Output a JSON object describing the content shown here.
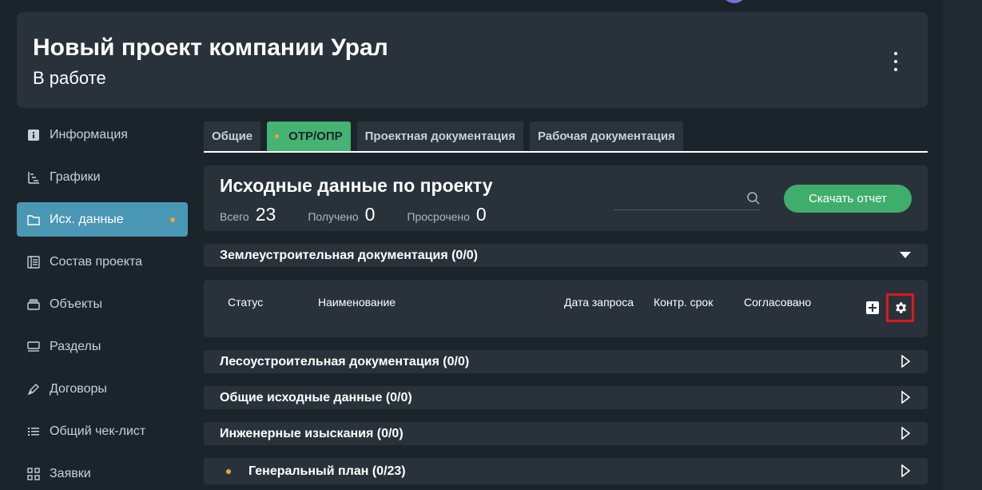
{
  "header": {
    "title": "Новый проект компании Урал",
    "status": "В работе",
    "menu_icon": "kebab-menu-icon"
  },
  "sidebar": {
    "items": [
      {
        "label": "Информация",
        "icon": "info-icon"
      },
      {
        "label": "Графики",
        "icon": "gantt-chart-icon"
      },
      {
        "label": "Исх. данные",
        "icon": "folder-icon",
        "active": true,
        "has_dot": true
      },
      {
        "label": "Состав проекта",
        "icon": "book-icon"
      },
      {
        "label": "Объекты",
        "icon": "layers-icon"
      },
      {
        "label": "Разделы",
        "icon": "sections-icon"
      },
      {
        "label": "Договоры",
        "icon": "pen-icon"
      },
      {
        "label": "Общий чек-лист",
        "icon": "checklist-icon"
      },
      {
        "label": "Заявки",
        "icon": "grid-icon"
      }
    ]
  },
  "tabs": [
    {
      "label": "Общие",
      "active": false
    },
    {
      "label": "ОТР/ОПР",
      "active": true,
      "has_dot": true
    },
    {
      "label": "Проектная документация",
      "active": false
    },
    {
      "label": "Рабочая документация",
      "active": false
    }
  ],
  "summary": {
    "title": "Исходные данные по проекту",
    "total_label": "Всего",
    "total_value": "23",
    "received_label": "Получено",
    "received_value": "0",
    "overdue_label": "Просрочено",
    "overdue_value": "0",
    "search_placeholder": "",
    "download_label": "Скачать отчет"
  },
  "sections": [
    {
      "title": "Землеустроительная документация (0/0)",
      "expanded": true
    },
    {
      "title": "Лесоустроительная документация (0/0)",
      "expanded": false
    },
    {
      "title": "Общие исходные данные (0/0)",
      "expanded": false
    },
    {
      "title": "Инженерные изыскания (0/0)",
      "expanded": false
    },
    {
      "title": "Генеральный план (0/23)",
      "expanded": false,
      "has_dot": true
    }
  ],
  "table": {
    "columns": [
      "Статус",
      "Наименование",
      "Дата запроса",
      "Контр. срок",
      "Согласовано"
    ],
    "add_icon": "plus-square-icon",
    "settings_icon": "gear-icon"
  },
  "colors": {
    "background": "#1c242b",
    "card": "#29323a",
    "accent_green": "#3fae6c",
    "sidebar_active": "#4a97b5",
    "dot_orange": "#f0a33c",
    "highlight_red": "#e01818"
  }
}
